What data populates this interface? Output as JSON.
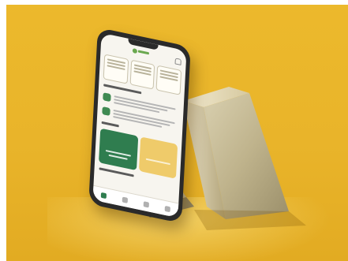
{
  "scene": {
    "background_color": "#e9b42a",
    "stand_color": "#cbbf9a",
    "phone_body_color": "#2a2a2a"
  },
  "phone_screen": {
    "icons": {
      "logo": "leaf-logo-icon",
      "notification": "bell-icon",
      "service_1": "card-icon",
      "service_2": "chat-icon",
      "tabs": [
        "home-icon",
        "catalog-icon",
        "orders-icon",
        "profile-icon"
      ]
    },
    "accent_green": "#2f7d4f",
    "accent_yellow": "#efcb6a"
  }
}
